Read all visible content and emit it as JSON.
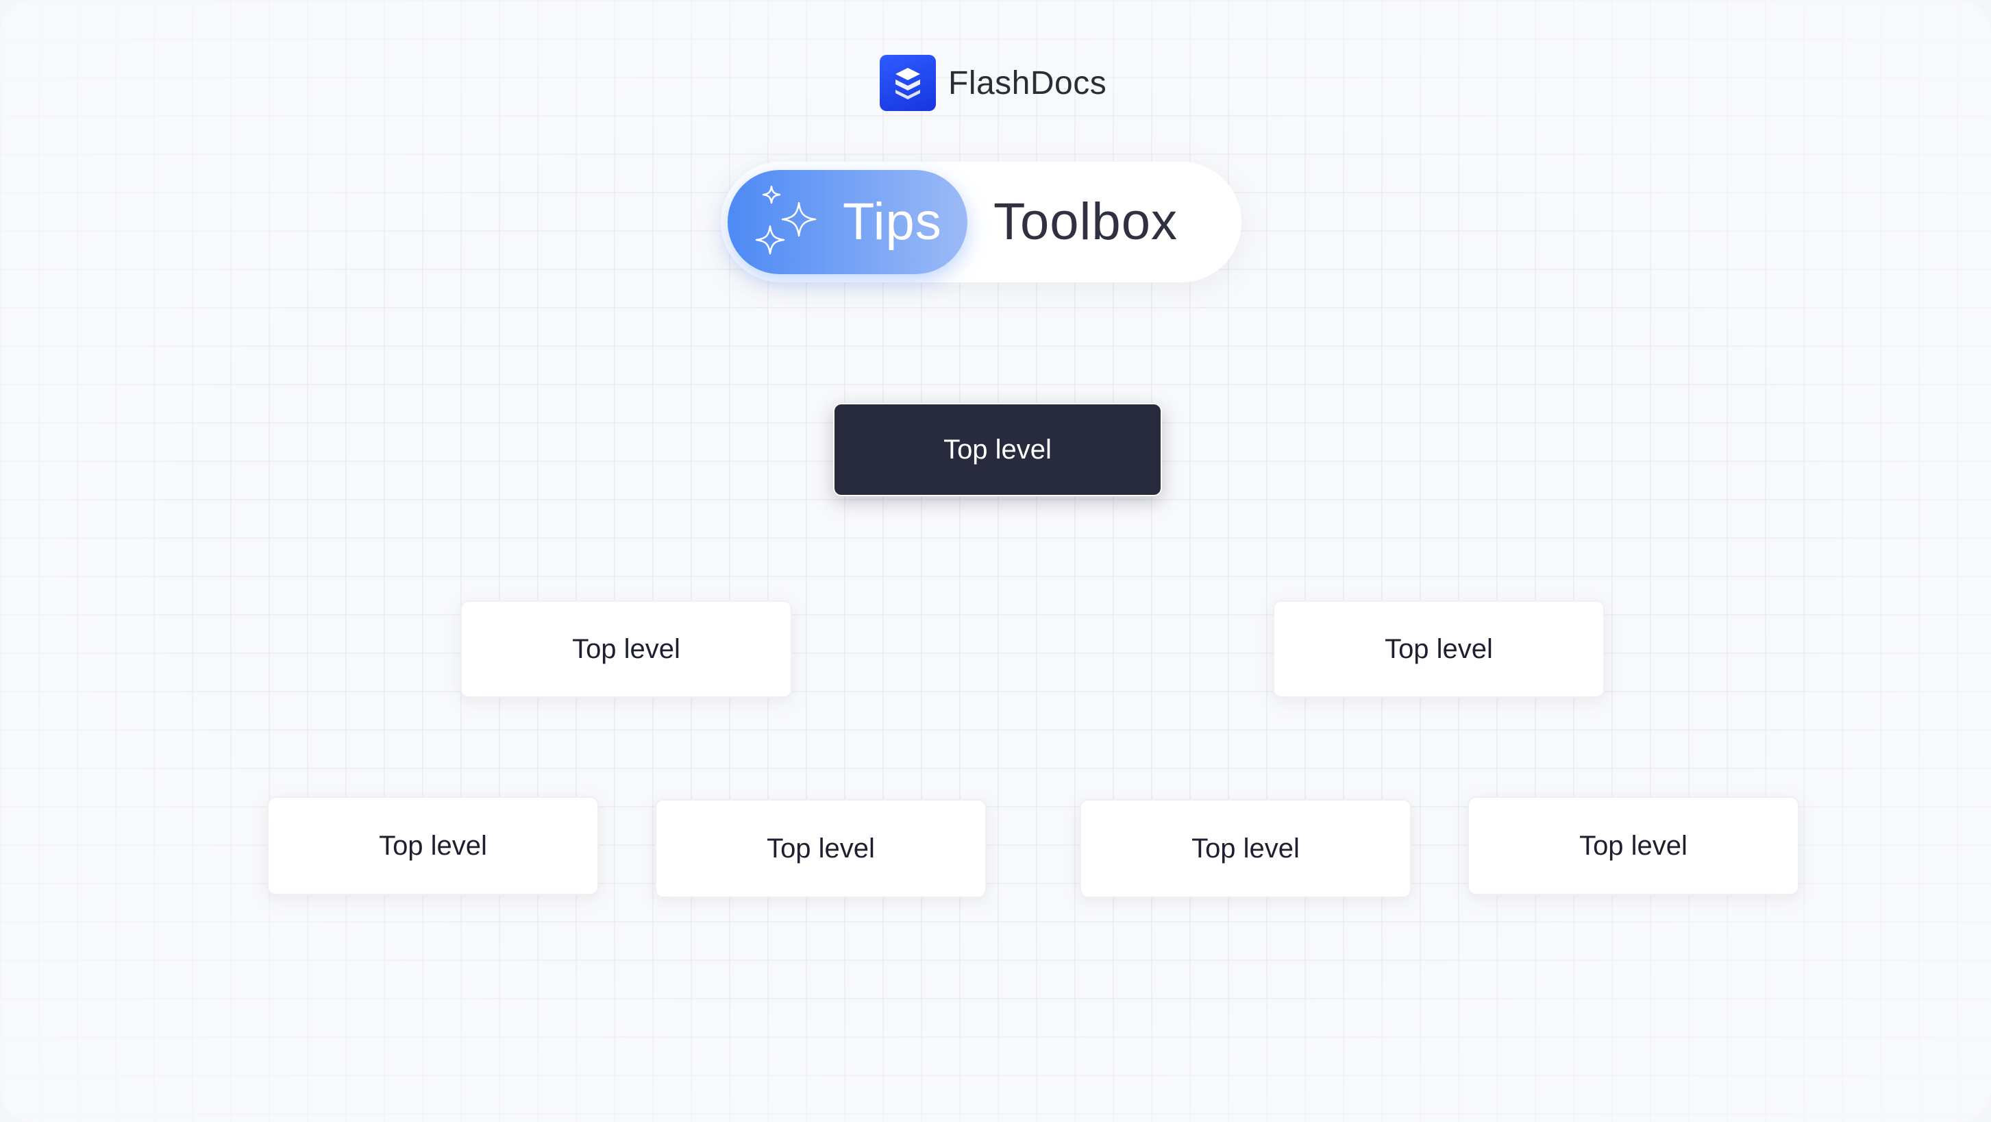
{
  "brand": {
    "name": "FlashDocs",
    "logo_color": "#1e44f0"
  },
  "header": {
    "active_tab": "Tips",
    "tab_label": "Toolbox",
    "accent_gradient": [
      "#4d8af5",
      "#9cbaf6"
    ]
  },
  "diagram": {
    "root": {
      "label": "Top level",
      "color": "#282a3e"
    },
    "level2": [
      {
        "label": "Top level"
      },
      {
        "label": "Top level"
      }
    ],
    "level3": [
      {
        "label": "Top level"
      },
      {
        "label": "Top level"
      },
      {
        "label": "Top level"
      },
      {
        "label": "Top level"
      }
    ]
  }
}
